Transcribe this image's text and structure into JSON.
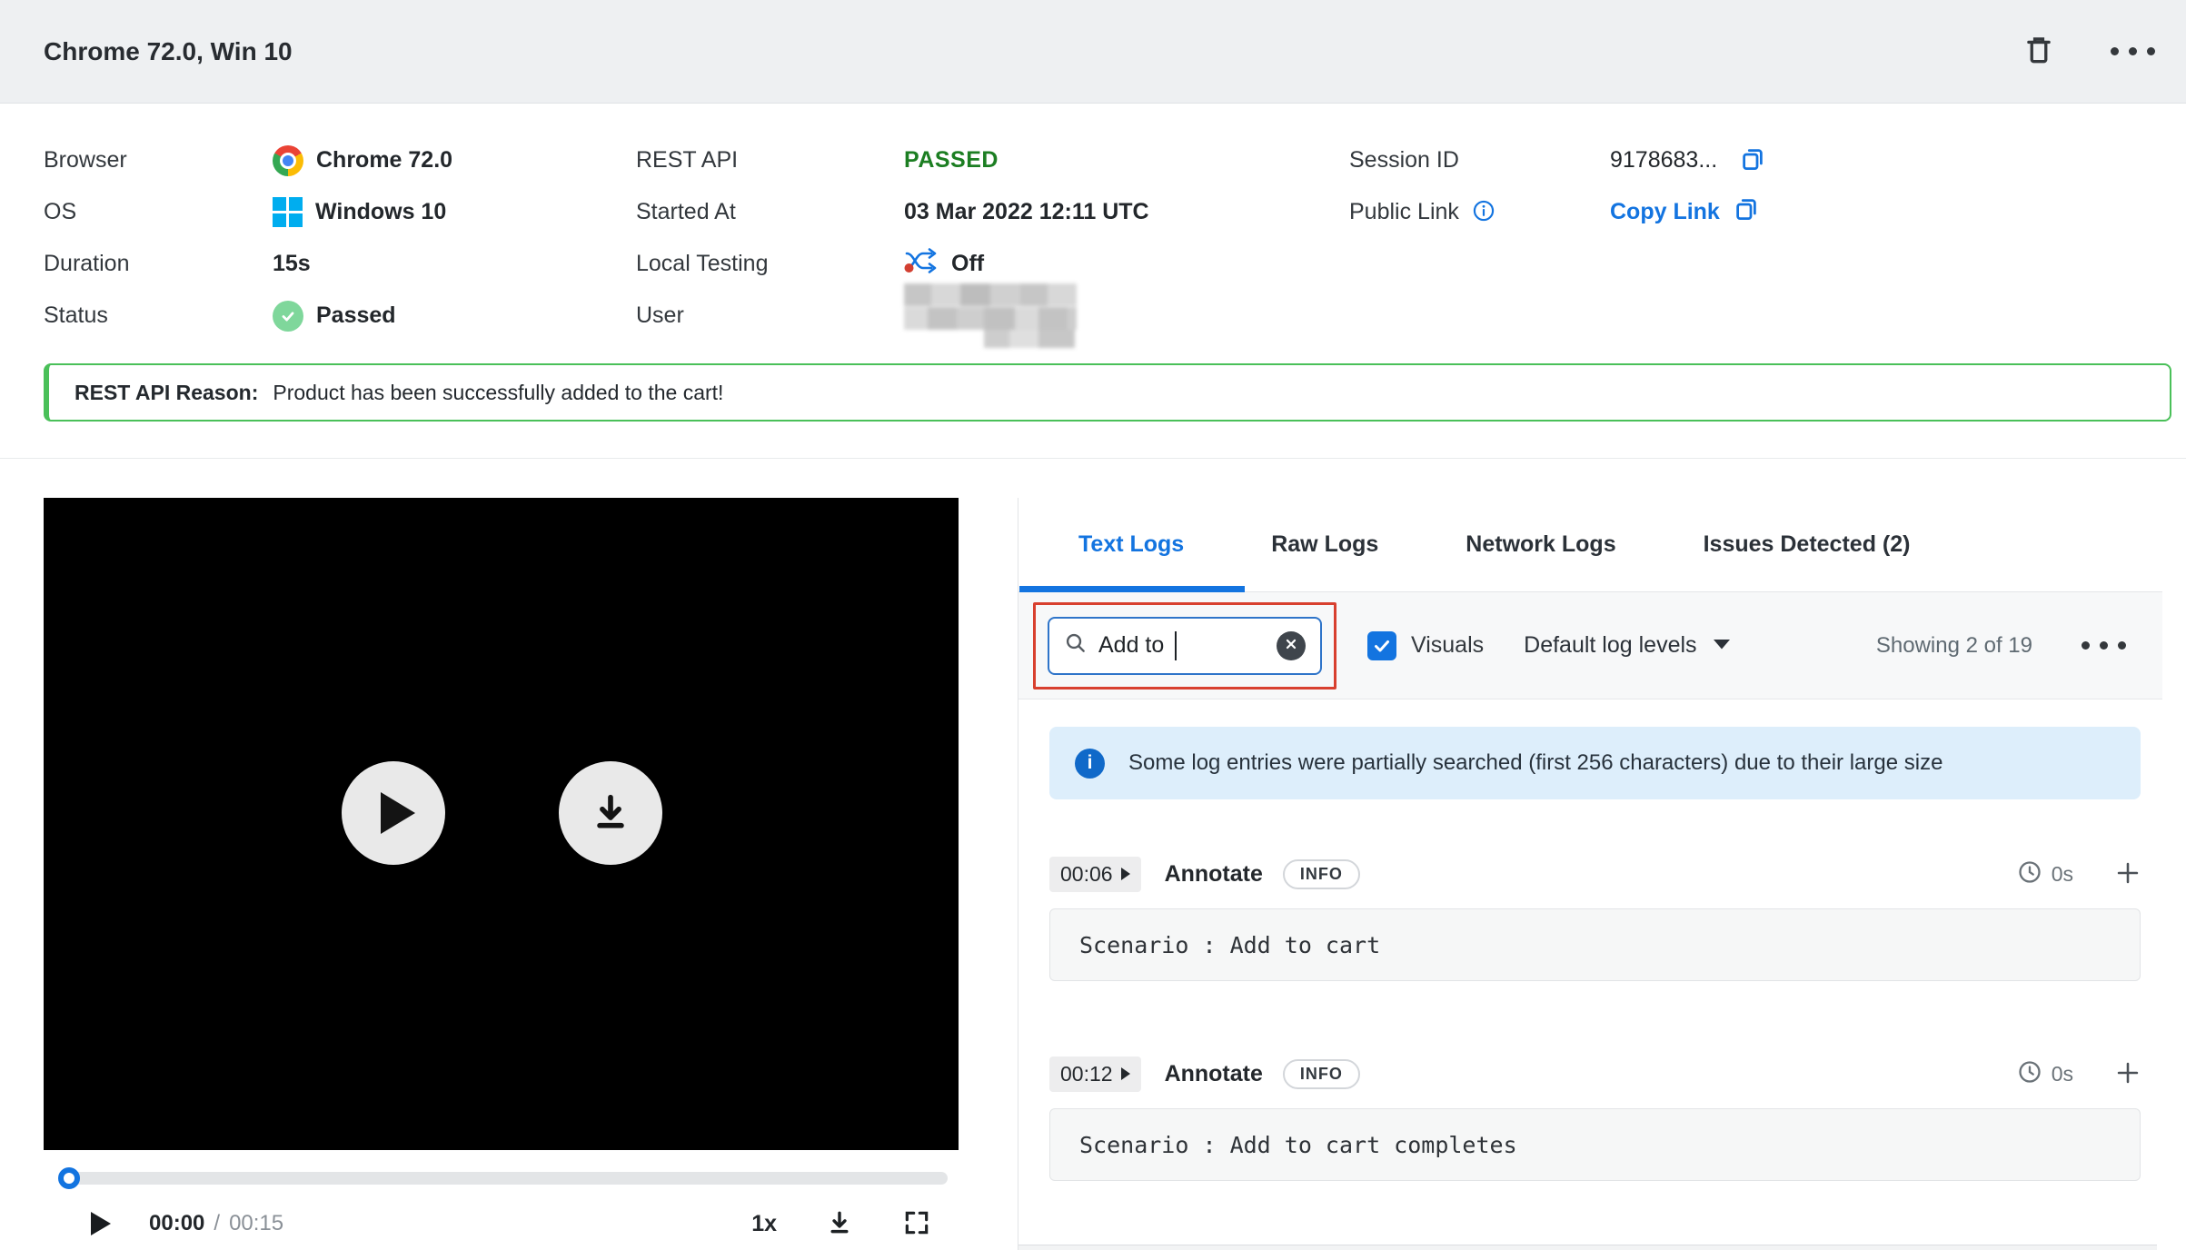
{
  "colors": {
    "accent_blue": "#1374e0",
    "success_text_green": "#1c7e22",
    "success_border_green": "#4ac059",
    "status_check_green": "#7fd79b",
    "annotation_red": "#d8402f",
    "notice_bg_blue": "#ddeefb",
    "topbar_bg": "#eef0f2"
  },
  "icons": [
    "delete-icon",
    "more-options-icon",
    "chrome-icon",
    "windows-icon",
    "passed-check-icon",
    "local-testing-icon",
    "copy-icon",
    "info-icon",
    "search-icon",
    "clear-icon",
    "checkbox-checked-icon",
    "caret-down-icon",
    "clock-icon",
    "add-icon",
    "play-icon",
    "download-icon",
    "fullscreen-icon"
  ],
  "topbar": {
    "title": "Chrome 72.0, Win 10"
  },
  "session_info": {
    "col1": [
      {
        "label": "Browser",
        "value": "Chrome 72.0"
      },
      {
        "label": "OS",
        "value": "Windows 10"
      },
      {
        "label": "Duration",
        "value": "15s"
      },
      {
        "label": "Status",
        "value": "Passed"
      }
    ],
    "col2": [
      {
        "label": "REST API",
        "value": "PASSED"
      },
      {
        "label": "Started At",
        "value": "03 Mar 2022 12:11 UTC"
      },
      {
        "label": "Local Testing",
        "value": "Off"
      },
      {
        "label": "User",
        "value": ""
      }
    ],
    "col3": [
      {
        "label": "Session ID",
        "value": "9178683..."
      },
      {
        "label": "Public Link",
        "value": "Copy Link"
      }
    ]
  },
  "reason_banner": {
    "label": "REST API Reason:",
    "text": "Product has been successfully added to the cart!"
  },
  "player": {
    "current_time": "00:00",
    "separator": "/",
    "total_time": "00:15",
    "speed": "1x"
  },
  "tabs": [
    {
      "label": "Text Logs",
      "active": true
    },
    {
      "label": "Raw Logs",
      "active": false
    },
    {
      "label": "Network Logs",
      "active": false
    },
    {
      "label": "Issues Detected (2)",
      "active": false
    }
  ],
  "toolbar": {
    "search_value": "Add to",
    "visuals_label": "Visuals",
    "log_levels_label": "Default log levels",
    "showing_text": "Showing 2 of 19"
  },
  "notice": {
    "text": "Some log entries were partially searched (first 256 characters) due to their large size"
  },
  "log_entries": [
    {
      "time": "00:06",
      "action": "Annotate",
      "level": "INFO",
      "duration": "0s",
      "code": "Scenario : Add to cart"
    },
    {
      "time": "00:12",
      "action": "Annotate",
      "level": "INFO",
      "duration": "0s",
      "code": "Scenario : Add to cart completes"
    }
  ]
}
